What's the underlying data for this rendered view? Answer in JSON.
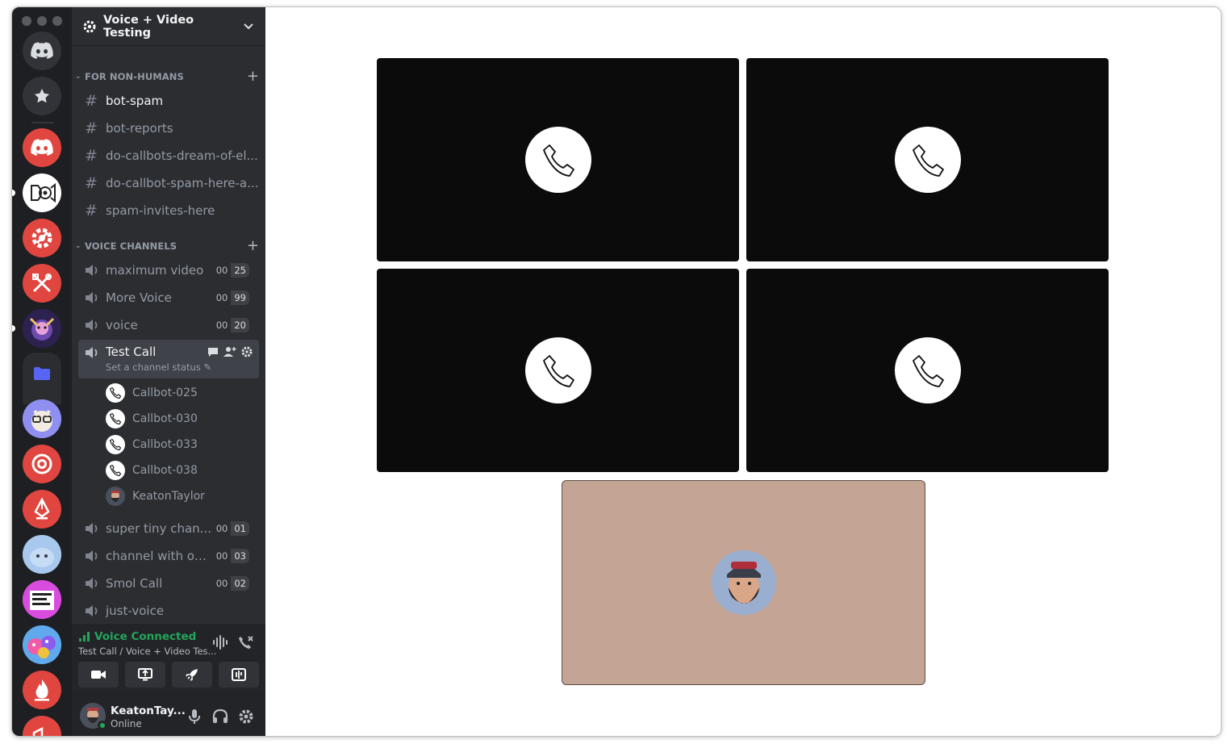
{
  "server": {
    "name": "Voice + Video Testing"
  },
  "categories": [
    {
      "label": "FOR NON-HUMANS"
    },
    {
      "label": "VOICE CHANNELS"
    }
  ],
  "text_channels": [
    {
      "name": "bot-spam",
      "selected": true
    },
    {
      "name": "bot-reports"
    },
    {
      "name": "do-callbots-dream-of-el..."
    },
    {
      "name": "do-callbot-spam-here-a..."
    },
    {
      "name": "spam-invites-here"
    }
  ],
  "voice_channels": [
    {
      "name": "maximum video",
      "count_a": "00",
      "count_b": "25"
    },
    {
      "name": "More Voice",
      "count_a": "00",
      "count_b": "99"
    },
    {
      "name": "voice",
      "count_a": "00",
      "count_b": "20"
    },
    {
      "name": "Test Call",
      "status": "Set a channel status"
    },
    {
      "name": "super tiny chan...",
      "count_a": "00",
      "count_b": "01"
    },
    {
      "name": "channel with op...",
      "count_a": "00",
      "count_b": "03"
    },
    {
      "name": "Smol Call",
      "count_a": "00",
      "count_b": "02"
    },
    {
      "name": "just-voice"
    }
  ],
  "test_call_members": [
    {
      "name": "Callbot-025"
    },
    {
      "name": "Callbot-030"
    },
    {
      "name": "Callbot-033"
    },
    {
      "name": "Callbot-038"
    },
    {
      "name": "KeatonTaylor"
    }
  ],
  "voice_status": {
    "title": "Voice Connected",
    "subtitle": "Test Call / Voice + Video Tes..."
  },
  "user": {
    "name": "KeatonTay...",
    "status": "Online"
  },
  "colors": {
    "rail": "#1e1f22",
    "sidebar": "#2b2d31",
    "connected_green": "#23a55a",
    "server_red": "#e0463f",
    "self_tile": "#c4a494"
  },
  "icons": {
    "rail": [
      "discord-logo-icon",
      "star-icon",
      "folder-icon"
    ],
    "tiles": "phone-icon"
  }
}
